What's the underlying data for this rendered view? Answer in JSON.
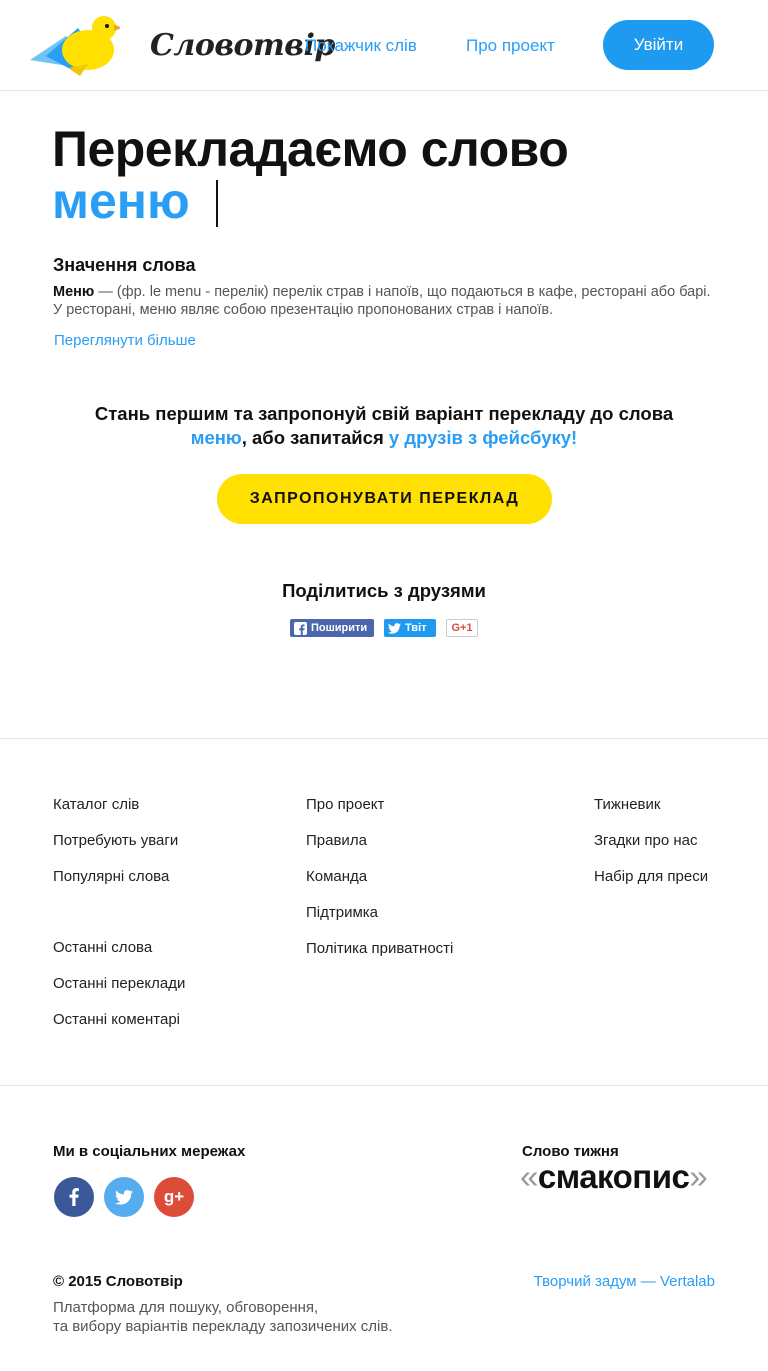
{
  "header": {
    "logo_text": "Словотвір",
    "nav": [
      "Покажчик слів",
      "Про проект"
    ],
    "login_label": "Увійти"
  },
  "main": {
    "title": "Перекладаємо слово",
    "word": "меню",
    "meaning_heading": "Значення слова",
    "meaning_term": "Меню",
    "meaning_text": " — (фр. le menu - перелік) перелік страв і напоїв, що подаються в кафе, ресторані або барі. У ресторані, меню являє собою презентацію пропонованих страв і напоїв.",
    "more_link": "Переглянути більше",
    "cta_text1": "Стань першим та запропонуй свій варіант перекладу до слова",
    "cta_word": "меню",
    "cta_text2": ", або запитайся ",
    "cta_link": "у друзів з фейсбуку!",
    "suggest_button": "ЗАПРОПОНУВАТИ ПЕРЕКЛАД",
    "share_heading": "Поділитись з друзями",
    "share_facebook": "Поширити",
    "share_twitter": "Твіт",
    "share_gplus": "G+1"
  },
  "footer": {
    "col1": [
      "Каталог слів",
      "Потребують уваги",
      "Популярні слова"
    ],
    "col1b": [
      "Останні слова",
      "Останні переклади",
      "Останні коментарі"
    ],
    "col2": [
      "Про проект",
      "Правила",
      "Команда",
      "Підтримка",
      "Політика приватності"
    ],
    "col3": [
      "Тижневик",
      "Згадки про нас",
      "Набір для преси"
    ],
    "social_heading": "Ми в соціальних мережах",
    "social_icons": [
      "facebook-icon",
      "twitter-icon",
      "google-plus-icon"
    ],
    "gplus_glyph": "g+",
    "word_of_week_heading": "Слово тижня",
    "word_of_week_open": "«",
    "word_of_week": "смакопис",
    "word_of_week_close": "»",
    "copyright": "© 2015 Словотвір",
    "description_line1": "Платформа для пошуку, обговорення,",
    "description_line2": "та вибору варіантів перекладу запозичених слів.",
    "credit": "Творчий задум — Vertalab"
  },
  "colors": {
    "accent": "#2a9df4",
    "yellow": "#ffe000",
    "facebook": "#3b5998",
    "twitter": "#55acee",
    "google_plus": "#dd4b39"
  }
}
